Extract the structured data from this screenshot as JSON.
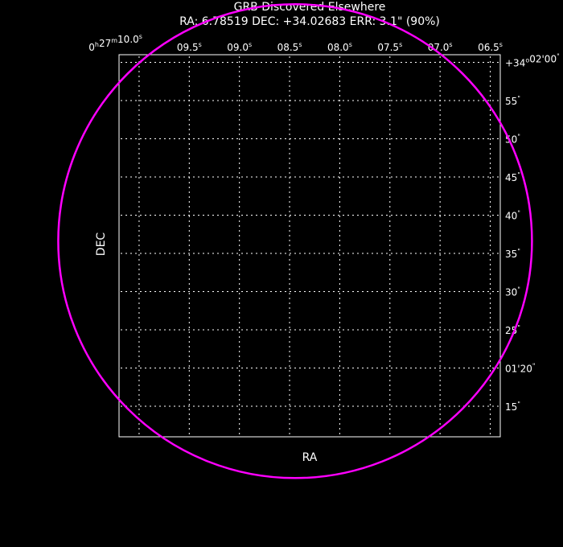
{
  "chart_data": {
    "type": "scatter",
    "title": "GRB Discovered Elsewhere",
    "subtitle": "RA: 6.78519  DEC: +34.02683  ERR: 3.1\" (90%)",
    "xlabel": "RA",
    "ylabel": "DEC",
    "grid": true,
    "x_tick_labels": [
      {
        "main": "0",
        "sup1": "h",
        "mid": "27",
        "sup2": "m",
        "tail": "10.0",
        "sup3": "s"
      },
      {
        "main": "09.5",
        "sup3": "s"
      },
      {
        "main": "09.0",
        "sup3": "s"
      },
      {
        "main": "08.5",
        "sup3": "s"
      },
      {
        "main": "08.0",
        "sup3": "s"
      },
      {
        "main": "07.5",
        "sup3": "s"
      },
      {
        "main": "07.0",
        "sup3": "s"
      },
      {
        "main": "06.5",
        "sup3": "s"
      }
    ],
    "y_tick_labels": [
      {
        "text": "+34°02'00\"",
        "pre": "+34",
        "deg": "o",
        "mid": "02'00",
        "post": "\""
      },
      {
        "text": "55\"",
        "pre": "55",
        "post": "\""
      },
      {
        "text": "50\"",
        "pre": "50",
        "post": "\""
      },
      {
        "text": "45\"",
        "pre": "45",
        "post": "\""
      },
      {
        "text": "40\"",
        "pre": "40",
        "post": "\""
      },
      {
        "text": "35\"",
        "pre": "35",
        "post": "\""
      },
      {
        "text": "30\"",
        "pre": "30",
        "post": "\""
      },
      {
        "text": "25\"",
        "pre": "25",
        "post": "\""
      },
      {
        "text": "01'20\"",
        "pre": "01'20",
        "post": "\""
      },
      {
        "text": "15\"",
        "pre": "15",
        "post": "\""
      }
    ],
    "x_ticks_sec": [
      10.0,
      9.5,
      9.0,
      8.5,
      8.0,
      7.5,
      7.0,
      6.5
    ],
    "y_ticks_arcsec": [
      120,
      115,
      110,
      105,
      100,
      95,
      90,
      85,
      80,
      75
    ],
    "xlim_sec": [
      10.2,
      6.4
    ],
    "ylim_arcsec": [
      121,
      71
    ],
    "error_circle": {
      "ra_deg": 6.78519,
      "dec_deg": 34.02683,
      "ra_sec": 8.445,
      "dec_arcsec": 96.6,
      "radius_arcsec": 3.1,
      "color": "#ff00ff"
    },
    "colors": {
      "background": "#000000",
      "axes": "#ffffff",
      "grid": "#ffffff"
    }
  }
}
